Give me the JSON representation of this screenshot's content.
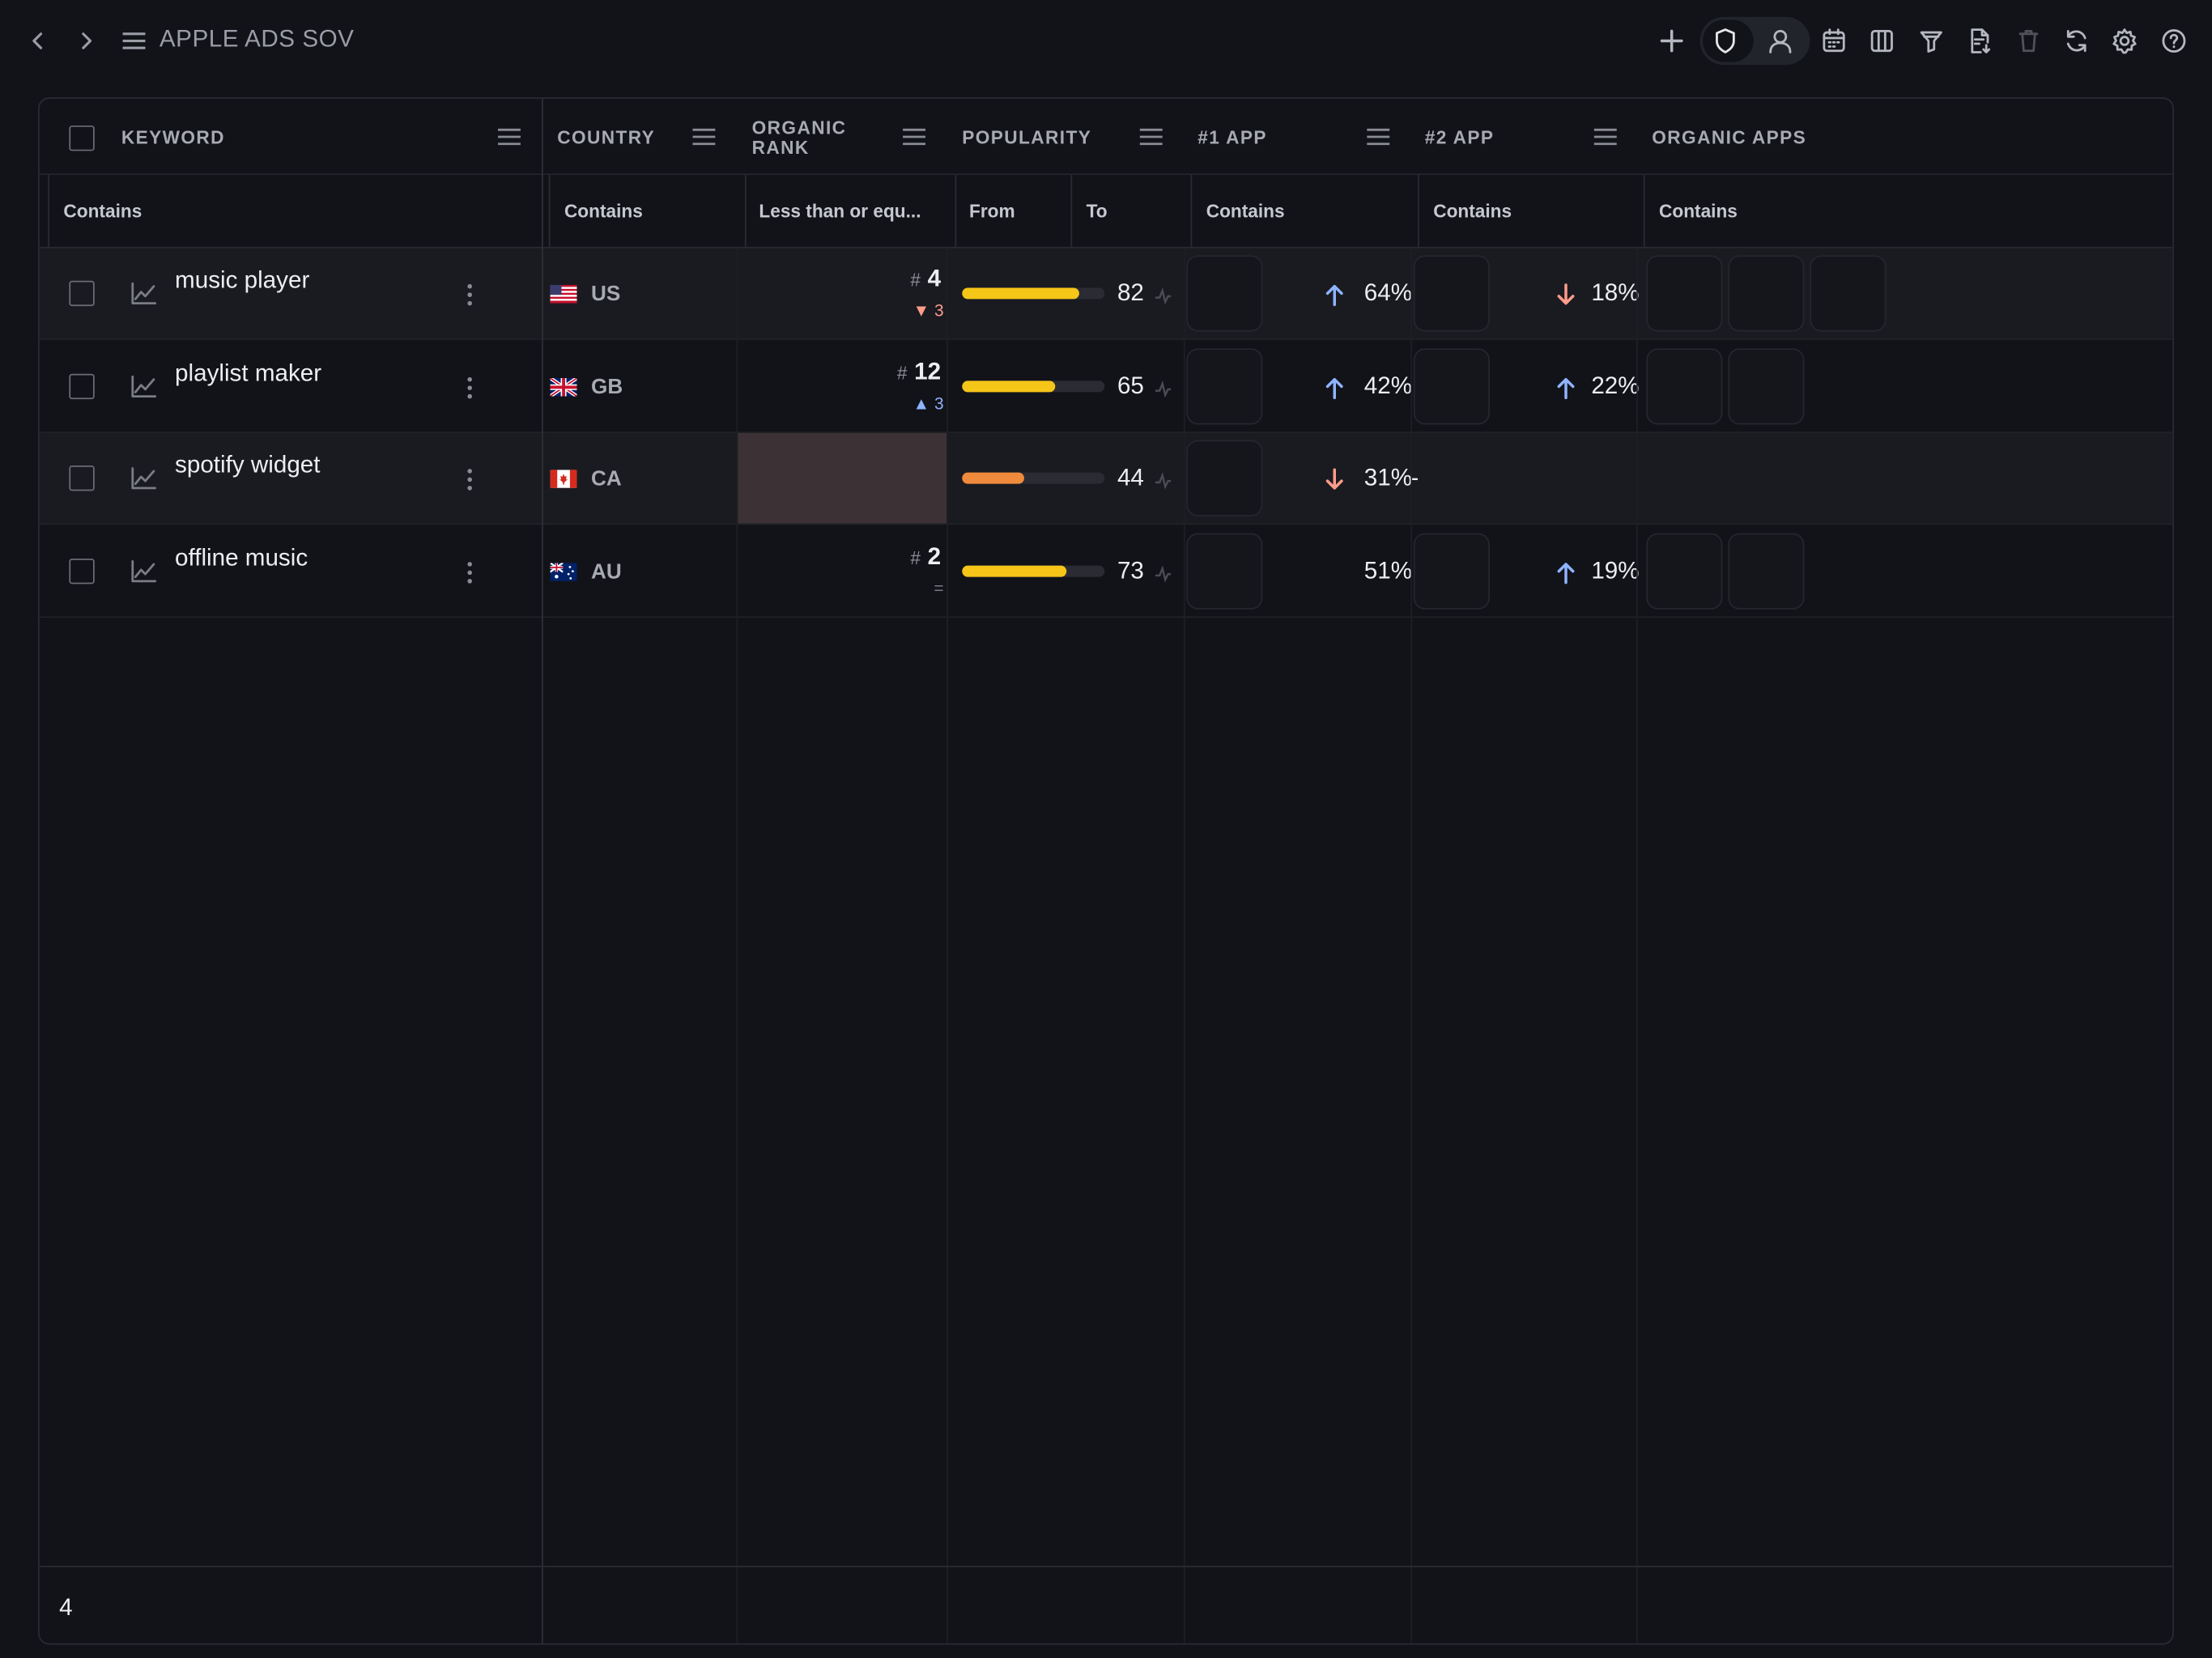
{
  "window": {
    "title": "APPLE ADS SOV"
  },
  "toolbar": {
    "icons": [
      "back-icon",
      "forward-icon",
      "menu-icon",
      "plus-icon",
      "shield-icon",
      "user-icon",
      "calendar-icon",
      "columns-icon",
      "filter-icon",
      "export-icon",
      "trash-icon",
      "refresh-icon",
      "settings-icon",
      "help-icon"
    ]
  },
  "columns": {
    "keyword": "KEYWORD",
    "country": "COUNTRY",
    "organic_rank": "ORGANIC RANK",
    "popularity": "POPULARITY",
    "app1": "#1 APP",
    "app2": "#2 APP",
    "organic_apps": "ORGANIC APPS"
  },
  "filters": {
    "keyword": "Contains",
    "country": "Contains",
    "organic_rank": "Less than or equ...",
    "pop_from": "From",
    "pop_to": "To",
    "app1": "Contains",
    "app2": "Contains",
    "organic_apps": "Contains"
  },
  "rows": [
    {
      "keyword": "music player",
      "country": "US",
      "rank_hash": "#",
      "rank": "4",
      "rank_change": "▼ 3",
      "rank_dir": "down",
      "popularity": "82",
      "popularity_value": 82,
      "app1_pct": "64%",
      "app1_dir": "up",
      "app2_pct": "18%",
      "app2_dir": "down",
      "organic_apps_count": 3
    },
    {
      "keyword": "playlist maker",
      "country": "GB",
      "rank_hash": "#",
      "rank": "12",
      "rank_change": "▲ 3",
      "rank_dir": "up",
      "popularity": "65",
      "popularity_value": 65,
      "app1_pct": "42%",
      "app1_dir": "up",
      "app2_pct": "22%",
      "app2_dir": "up",
      "organic_apps_count": 2
    },
    {
      "keyword": "spotify widget",
      "country": "CA",
      "rank_hash": "",
      "rank": "",
      "rank_change": "",
      "rank_dir": "none",
      "popularity": "44",
      "popularity_value": 44,
      "app1_pct": "31%",
      "app1_dir": "down",
      "app2_pct": "-",
      "app2_dir": "none",
      "organic_apps_count": 0
    },
    {
      "keyword": "offline music",
      "country": "AU",
      "rank_hash": "#",
      "rank": "2",
      "rank_change": "=",
      "rank_dir": "same",
      "popularity": "73",
      "popularity_value": 73,
      "app1_pct": "51%",
      "app1_dir": "none",
      "app2_pct": "19%",
      "app2_dir": "up",
      "organic_apps_count": 2
    }
  ],
  "footer": {
    "row_count": "4"
  },
  "colors": {
    "accent_up": "#8fb4ff",
    "accent_down": "#ff9c8a",
    "bar_yellow": "#f5c518",
    "bar_orange": "#f08a3c",
    "background": "#121319"
  }
}
